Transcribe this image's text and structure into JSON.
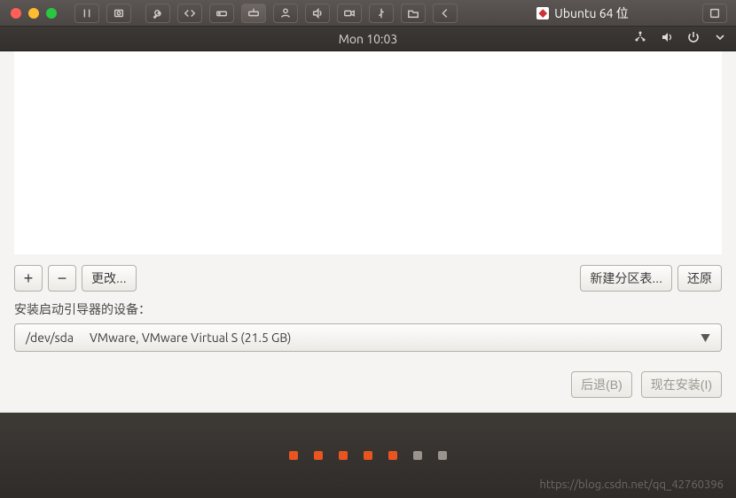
{
  "mac_titlebar": {
    "window_title": "Ubuntu 64 位"
  },
  "ubuntu_menubar": {
    "clock": "Mon 10:03"
  },
  "installer": {
    "toolbar": {
      "add_label": "+",
      "remove_label": "−",
      "change_label": "更改...",
      "new_table_label": "新建分区表...",
      "revert_label": "还原"
    },
    "bootloader": {
      "label": "安装启动引导器的设备：",
      "selected_device": "/dev/sda",
      "selected_desc": "VMware, VMware Virtual S (21.5 GB)"
    },
    "footer": {
      "back_label": "后退(B)",
      "install_label": "现在安装(I)"
    }
  },
  "progress": {
    "total": 7,
    "active": 5
  },
  "watermark": "https://blog.csdn.net/qq_42760396"
}
